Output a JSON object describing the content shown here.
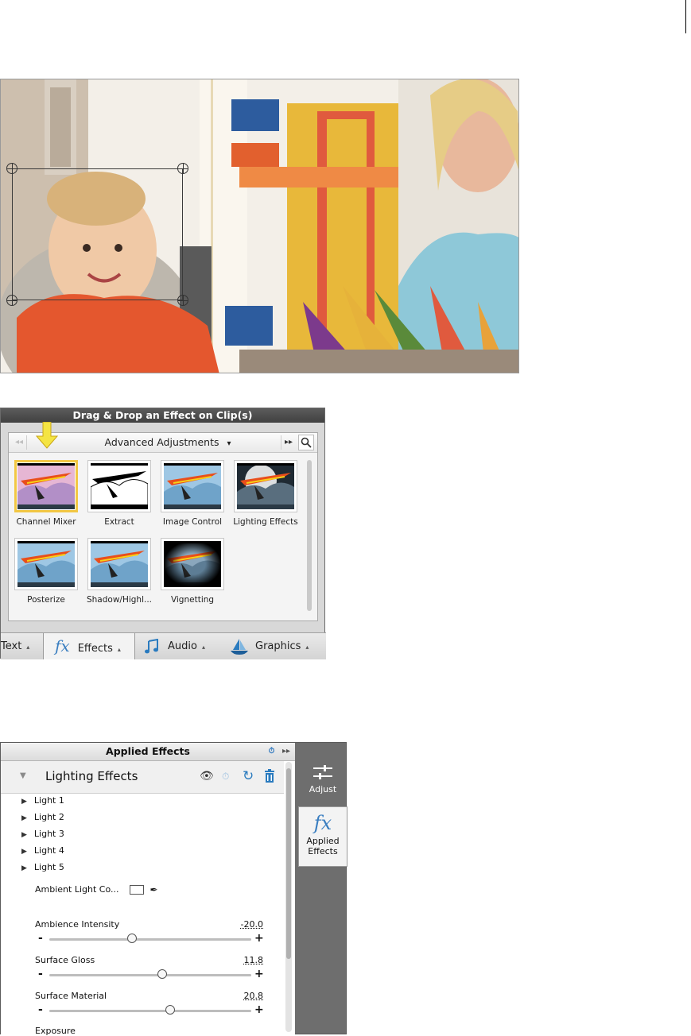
{
  "preview": {
    "description_colors": {
      "wall": "#e9e2d6",
      "shirt": "#e4572e",
      "toy": "#e8b83a",
      "bg_blue": "#2d5c9e"
    }
  },
  "effects_panel": {
    "title": "Drag & Drop an Effect on Clip(s)",
    "category": "Advanced Adjustments",
    "category_caret": "▾",
    "nav_prev": "◂◂",
    "nav_next": "▸▸",
    "search_icon": "search-icon",
    "effects": [
      {
        "label": "Channel Mixer",
        "selected": true
      },
      {
        "label": "Extract",
        "selected": false
      },
      {
        "label": "Image Control",
        "selected": false
      },
      {
        "label": "Lighting Effects",
        "selected": false
      },
      {
        "label": "Posterize",
        "selected": false
      },
      {
        "label": "Shadow/Highl...",
        "selected": false
      },
      {
        "label": "Vignetting",
        "selected": false
      }
    ],
    "tabs": [
      {
        "label": "Text",
        "caret": "▴"
      },
      {
        "label": "Effects",
        "caret": "▴",
        "icon": "fx"
      },
      {
        "label": "Audio",
        "caret": "▴"
      },
      {
        "label": "Graphics",
        "caret": "▴"
      }
    ],
    "accent": "#f2c744"
  },
  "applied": {
    "title": "Applied Effects",
    "effect_name": "Lighting Effects",
    "lights": [
      "Light 1",
      "Light 2",
      "Light 3",
      "Light 4",
      "Light 5"
    ],
    "ambient_label": "Ambient Light Co...",
    "sliders": [
      {
        "label": "Ambience Intensity",
        "value": "-20.0",
        "fraction": 0.41
      },
      {
        "label": "Surface Gloss",
        "value": "11.8",
        "fraction": 0.56
      },
      {
        "label": "Surface Material",
        "value": "20.8",
        "fraction": 0.6
      }
    ],
    "exposure_label": "Exposure",
    "side": {
      "adjust_label": "Adjust",
      "applied_label_1": "Applied",
      "applied_label_2": "Effects",
      "fx_glyph": "fx"
    },
    "accent": "#3a7ec0"
  }
}
